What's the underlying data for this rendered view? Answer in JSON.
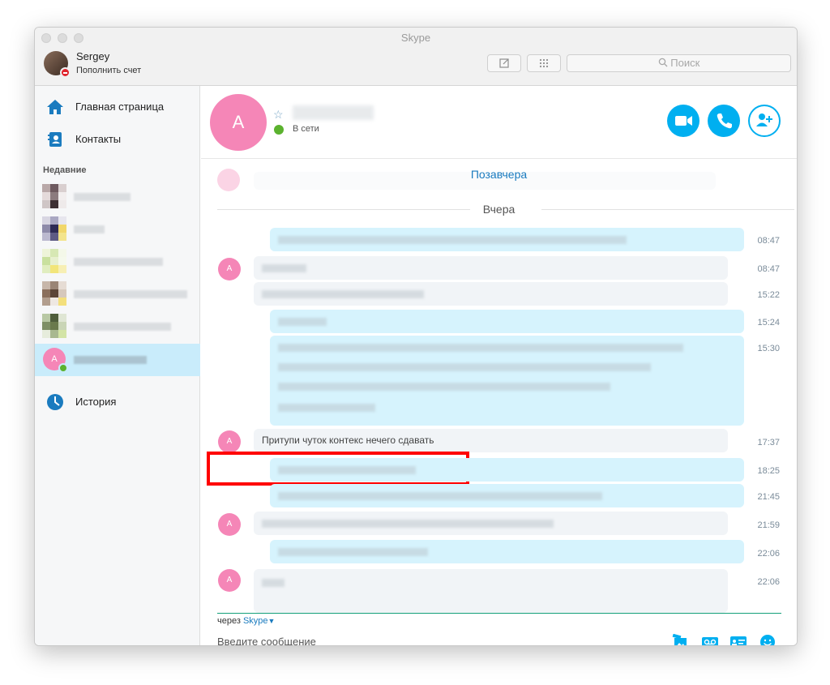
{
  "window": {
    "title": "Skype"
  },
  "profile": {
    "name": "Sergey",
    "credit_link": "Пополнить счет"
  },
  "search": {
    "placeholder": "Поиск"
  },
  "nav": [
    {
      "label": "Главная страница",
      "icon": "home-icon"
    },
    {
      "label": "Контакты",
      "icon": "contacts-icon"
    },
    {
      "label": "История",
      "icon": "clock-icon"
    }
  ],
  "recent": {
    "heading": "Недавние",
    "active_avatar_initial": "A"
  },
  "conversation": {
    "avatar_initial": "A",
    "status": "В сети",
    "date_separators": [
      "Позавчера",
      "Вчера"
    ],
    "visible_message": "Притупи чуток контекс нечего сдавать",
    "times": [
      "08:47",
      "08:47",
      "15:22",
      "15:24",
      "15:30",
      "17:37",
      "18:25",
      "21:45",
      "21:59",
      "22:06",
      "22:06"
    ]
  },
  "composer": {
    "via_prefix": "через",
    "via_service": "Skype",
    "placeholder": "Введите сообщение"
  },
  "colors": {
    "accent": "#00aff0",
    "avatar_pink": "#f586b7",
    "online_green": "#5bb22e",
    "highlight": "#ff0000"
  }
}
